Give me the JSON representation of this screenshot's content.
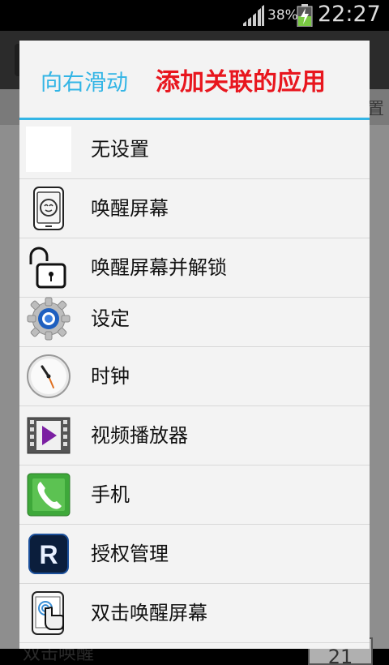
{
  "status_bar": {
    "battery_percent": "38%",
    "time": "22:27"
  },
  "background": {
    "tab_text": "置",
    "bottom_text": "双击唤醒",
    "bottom_box": "21"
  },
  "dialog": {
    "title": "向右滑动",
    "title_highlight": "添加关联的应用",
    "items": [
      {
        "label": "无设置",
        "icon": "blank-icon"
      },
      {
        "label": "唤醒屏幕",
        "icon": "phone-wake-icon"
      },
      {
        "label": "唤醒屏幕并解锁",
        "icon": "padlock-open-icon"
      },
      {
        "label": "设定",
        "icon": "settings-gear-icon"
      },
      {
        "label": "时钟",
        "icon": "clock-icon"
      },
      {
        "label": "视频播放器",
        "icon": "video-player-icon"
      },
      {
        "label": "手机",
        "icon": "phone-handset-icon"
      },
      {
        "label": "授权管理",
        "icon": "r-logo-icon"
      },
      {
        "label": "双击唤醒屏幕",
        "icon": "double-tap-icon"
      }
    ]
  },
  "colors": {
    "accent": "#33b5e5",
    "highlight": "#e8161e"
  }
}
